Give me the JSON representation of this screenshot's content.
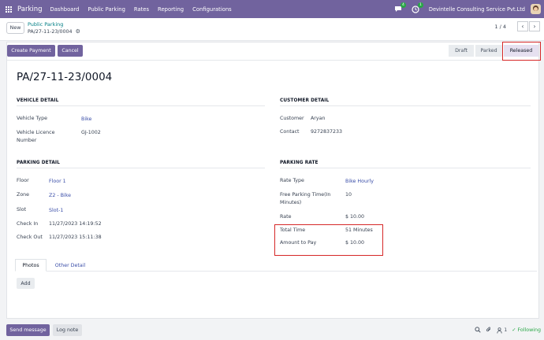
{
  "navbar": {
    "app_name": "Parking",
    "menu": [
      "Dashboard",
      "Public Parking",
      "Rates",
      "Reporting",
      "Configurations"
    ],
    "chat_badge": "4",
    "activity_badge": "1",
    "company": "Devintelle Consulting Service Pvt.Ltd"
  },
  "control": {
    "new_label": "New",
    "breadcrumb_parent": "Public Parking",
    "breadcrumb_current": "PA/27-11-23/0004",
    "pager": "1 / 4"
  },
  "statusbar": {
    "create_payment": "Create Payment",
    "cancel": "Cancel",
    "stages": [
      "Draft",
      "Parked",
      "Released"
    ],
    "active_stage": "Released"
  },
  "record": {
    "title": "PA/27-11-23/0004",
    "vehicle_detail": {
      "title": "VEHICLE DETAIL",
      "type_label": "Vehicle Type",
      "type_value": "Bike",
      "licence_label_1": "Vehicle Licence",
      "licence_label_2": "Number",
      "licence_value": "GJ-1002"
    },
    "customer_detail": {
      "title": "CUSTOMER DETAIL",
      "customer_label": "Customer",
      "customer_value": "Aryan",
      "contact_label": "Contact",
      "contact_value": "9272837233"
    },
    "parking_detail": {
      "title": "PARKING DETAIL",
      "floor_label": "Floor",
      "floor_value": "Floor 1",
      "zone_label": "Zone",
      "zone_value": "Z2 - Bike",
      "slot_label": "Slot",
      "slot_value": "Slot-1",
      "checkin_label": "Check In",
      "checkin_value": "11/27/2023 14:19:52",
      "checkout_label": "Check Out",
      "checkout_value": "11/27/2023 15:11:38"
    },
    "parking_rate": {
      "title": "PARKING RATE",
      "rate_type_label": "Rate Type",
      "rate_type_value": "Bike Hourly",
      "free_time_label_1": "Free Parking Time(In",
      "free_time_label_2": "Minutes)",
      "free_time_value": "10",
      "rate_label": "Rate",
      "rate_value": "$ 10.00",
      "total_time_label": "Total Time",
      "total_time_value": "51 Minutes",
      "amount_label": "Amount to Pay",
      "amount_value": "$ 10.00"
    }
  },
  "tabs": [
    "Photos",
    "Other Detail"
  ],
  "add_label": "Add",
  "chatter": {
    "send_message": "Send message",
    "log_note": "Log note",
    "followers": "1",
    "following": "Following"
  },
  "colors": {
    "brand": "#71639e",
    "link": "#3a4ea8",
    "highlight": "#d62828",
    "following": "#28a745"
  }
}
